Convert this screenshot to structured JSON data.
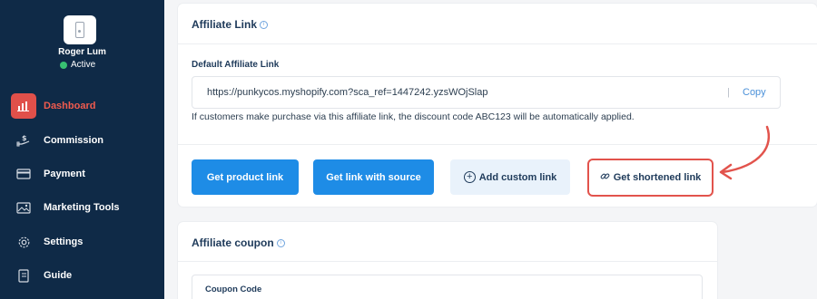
{
  "user": {
    "name": "Roger Lum",
    "status": "Active"
  },
  "sidebar": {
    "items": [
      {
        "label": "Dashboard",
        "icon": "bar-chart-icon",
        "active": true
      },
      {
        "label": "Commission",
        "icon": "dollar-hand-icon",
        "active": false
      },
      {
        "label": "Payment",
        "icon": "credit-card-icon",
        "active": false
      },
      {
        "label": "Marketing Tools",
        "icon": "image-icon",
        "active": false
      },
      {
        "label": "Settings",
        "icon": "gear-icon",
        "active": false
      },
      {
        "label": "Guide",
        "icon": "book-icon",
        "active": false
      }
    ]
  },
  "affiliate_link": {
    "title": "Affiliate Link",
    "default_label": "Default Affiliate Link",
    "url": "https://punkycos.myshopify.com?sca_ref=1447242.yzsWOjSlap",
    "separator": "|",
    "copy_label": "Copy",
    "help_text": "If customers make purchase via this affiliate link, the discount code ABC123 will be automatically applied."
  },
  "actions": {
    "product_link": "Get product link",
    "link_with_source": "Get link with source",
    "custom_link": "Add custom link",
    "shortened_link": "Get shortened link"
  },
  "coupon": {
    "title": "Affiliate coupon",
    "code_label": "Coupon Code"
  },
  "colors": {
    "sidebar_bg": "#0f2a47",
    "accent_red": "#e0504a",
    "primary_blue": "#1e8ce6",
    "status_green": "#38c172"
  }
}
